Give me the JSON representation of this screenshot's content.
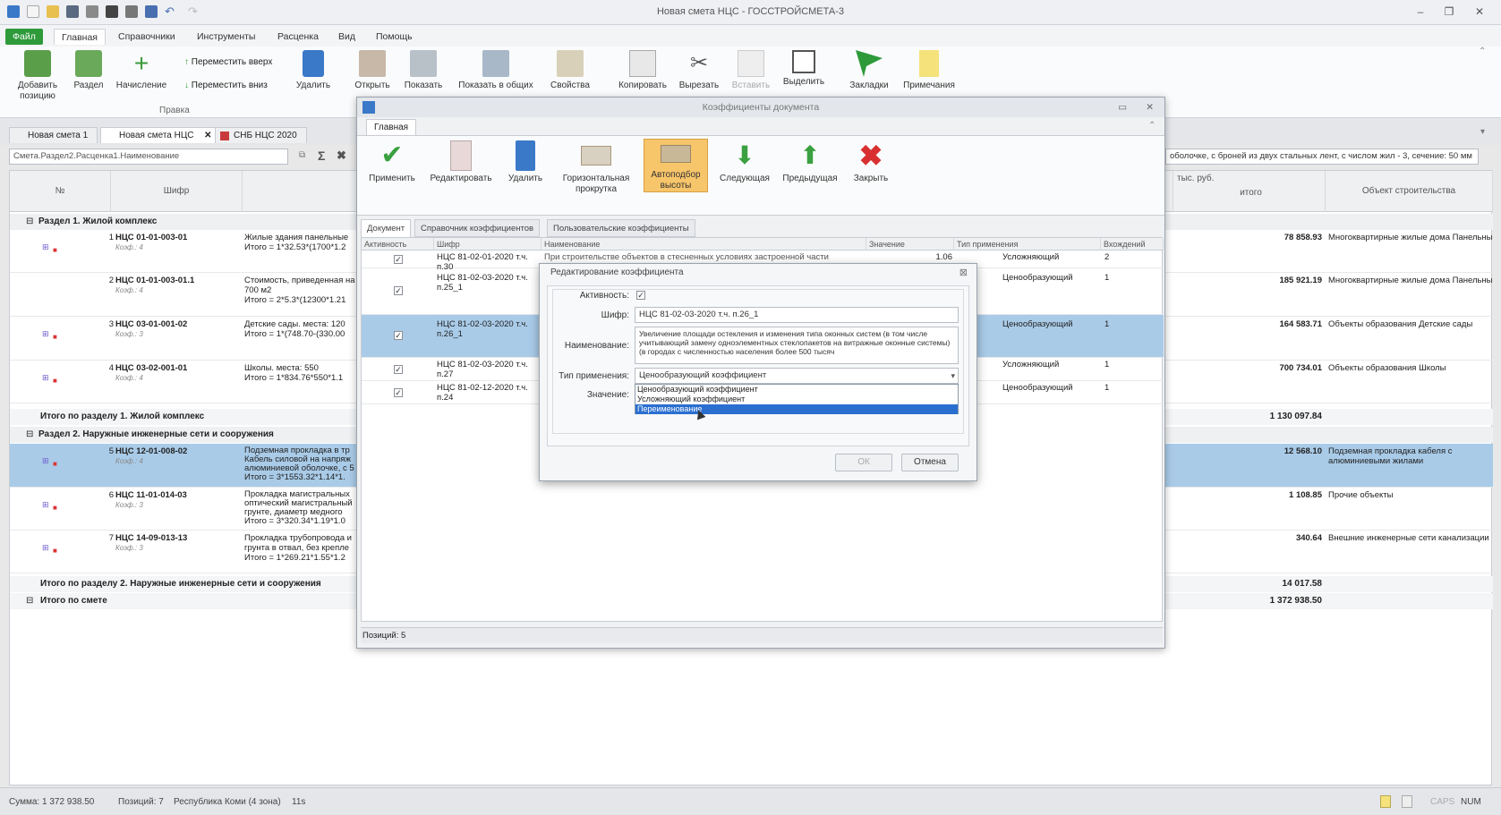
{
  "window": {
    "title": "Новая смета НЦС - ГОССТРОЙСМЕТА-3"
  },
  "ribbon_tabs": [
    "Файл",
    "Главная",
    "Справочники",
    "Инструменты",
    "Расценка",
    "Вид",
    "Помощь"
  ],
  "ribbon": {
    "add_position": "Добавить позицию",
    "section": "Раздел",
    "accrual": "Начисление",
    "move_up": "Переместить вверх",
    "move_down": "Переместить вниз",
    "delete": "Удалить",
    "open": "Открыть",
    "show": "Показать",
    "show_in_common": "Показать в общих",
    "properties": "Свойства",
    "copy": "Копировать",
    "cut": "Вырезать",
    "paste": "Вставить",
    "select": "Выделить",
    "bookmarks": "Закладки",
    "notes": "Примечания",
    "group_edit": "Правка"
  },
  "doc_tabs": [
    "Новая смета 1",
    "Новая смета НЦС",
    "СНБ НЦС 2020"
  ],
  "formula_bar": {
    "path": "Смета.Раздел2.Расценка1.Наименование",
    "right_text": "оболочке, с броней из двух стальных лент, с числом жил - 3, сечение: 50 мм"
  },
  "grid": {
    "headers": {
      "num": "№",
      "code": "Шифр",
      "units": "тыс. руб.",
      "total": "итого",
      "object": "Объект строительства"
    },
    "section1": "Раздел 1. Жилой комплекс",
    "section2": "Раздел 2. Наружные инженерные сети и сооружения",
    "total_section1": "Итого по разделу 1. Жилой комплекс",
    "total_section1_value": "1 130 097.84",
    "total_section2": "Итого по разделу 2. Наружные инженерные сети и сооружения",
    "total_section2_value": "14 017.58",
    "total_estimate": "Итого по смете",
    "total_estimate_value": "1 372 938.50",
    "rows": [
      {
        "num": "1",
        "code": "НЦС 01-01-003-01",
        "koef": "Коэф.: 4",
        "name1": "Жилые здания панельные",
        "name2": "Итого = 1*32.53*(1700*1.2",
        "total": "78 858.93",
        "object": "Многоквартирные жилые дома Панельные"
      },
      {
        "num": "2",
        "code": "НЦС 01-01-003-01.1",
        "koef": "Коэф.: 4",
        "name1": "Стоимость, приведенная на",
        "name2": "700 м2",
        "name3": "Итого = 2*5.3*(12300*1.21",
        "total": "185 921.19",
        "object": "Многоквартирные жилые дома Панельные"
      },
      {
        "num": "3",
        "code": "НЦС 03-01-001-02",
        "koef": "Коэф.: 3",
        "name1": "Детские сады. места: 120",
        "name2": "Итого = 1*(748.70-(330.00",
        "total": "164 583.71",
        "object": "Объекты образования Детские сады"
      },
      {
        "num": "4",
        "code": "НЦС 03-02-001-01",
        "koef": "Коэф.: 4",
        "name1": "Школы. места: 550",
        "name2": "Итого = 1*834.76*550*1.1",
        "total": "700 734.01",
        "object": "Объекты образования Школы"
      },
      {
        "num": "5",
        "code": "НЦС 12-01-008-02",
        "koef": "Коэф.: 4",
        "name1": "Подземная прокладка в тр",
        "name2": "Кабель силовой на напряж",
        "name3": "алюминиевой оболочке, с 5",
        "name4": "Итого = 3*1553.32*1.14*1.",
        "total": "12 568.10",
        "object": "Подземная прокладка кабеля с алюминиевыми жилами"
      },
      {
        "num": "6",
        "code": "НЦС 11-01-014-03",
        "koef": "Коэф.: 3",
        "name1": "Прокладка магистральных",
        "name2": "оптический магистральный",
        "name3": "грунте, диаметр медного",
        "name4": "Итого = 3*320.34*1.19*1.0",
        "total": "1 108.85",
        "object": "Прочие объекты"
      },
      {
        "num": "7",
        "code": "НЦС 14-09-013-13",
        "koef": "Коэф.: 3",
        "name1": "Прокладка трубопровода и",
        "name2": "грунта в отвал, без крепле",
        "name3": "Итого = 1*269.21*1.55*1.2",
        "total": "340.64",
        "object": "Внешние инженерные сети канализации"
      }
    ]
  },
  "coef_dialog": {
    "title": "Коэффициенты документа",
    "tab": "Главная",
    "buttons": {
      "apply": "Применить",
      "edit": "Редактировать",
      "delete": "Удалить",
      "hscroll": "Горизонтальная прокрутка",
      "autofit": "Автоподбор высоты",
      "next": "Следующая",
      "prev": "Предыдущая",
      "close": "Закрыть"
    },
    "inner_tabs": [
      "Документ",
      "Справочник коэффициентов",
      "Пользовательские коэффициенты"
    ],
    "headers": {
      "active": "Активность",
      "code": "Шифр",
      "name": "Наименование",
      "value": "Значение",
      "type": "Тип применения",
      "count": "Вхождений"
    },
    "rows": [
      {
        "code": "НЦС 81-02-01-2020 т.ч. п.30",
        "name": "При строительстве объектов в стесненных условиях застроенной части",
        "value": "1.06",
        "type": "Усложняющий",
        "count": "2"
      },
      {
        "code": "НЦС 81-02-03-2020 т.ч. п.25_1",
        "name": "",
        "value": "",
        "type": "Ценообразующий",
        "count": "1"
      },
      {
        "code": "НЦС 81-02-03-2020 т.ч. п.26_1",
        "name": "",
        "value": "",
        "type": "Ценообразующий",
        "count": "1"
      },
      {
        "code": "НЦС 81-02-03-2020 т.ч. п.27",
        "name": "",
        "value": "",
        "type": "Усложняющий",
        "count": "1"
      },
      {
        "code": "НЦС 81-02-12-2020 т.ч. п.24",
        "name": "",
        "value": "",
        "type": "Ценообразующий",
        "count": "1"
      }
    ],
    "positions": "Позиций: 5"
  },
  "edit_dialog": {
    "title": "Редактирование коэффициента",
    "activity_label": "Активность:",
    "code_label": "Шифр:",
    "code_value": "НЦС 81-02-03-2020 т.ч. п.26_1",
    "name_label": "Наименование:",
    "name_value": "Увеличение площади остекления и изменения типа оконных систем (в том числе учитывающий замену одноэлементных стеклопакетов на витражные оконные системы) (в городах с численностью населения более 500 тысяч",
    "type_label": "Тип применения:",
    "type_value": "Ценообразующий коэффициент",
    "value_label": "Значение:",
    "options": [
      "Ценообразующий коэффициент",
      "Усложняющий коэффициент",
      "Переименование"
    ],
    "ok": "ОК",
    "cancel": "Отмена"
  },
  "status_bar": {
    "sum": "Сумма: 1 372 938.50",
    "positions": "Позиций: 7",
    "region": "Республика Коми (4 зона)",
    "time": "11s",
    "caps": "CAPS",
    "num": "NUM"
  },
  "colors": {
    "selection": "#a9cbe8",
    "file_tab": "#2e9a3a",
    "accent": "#3a78c8"
  }
}
